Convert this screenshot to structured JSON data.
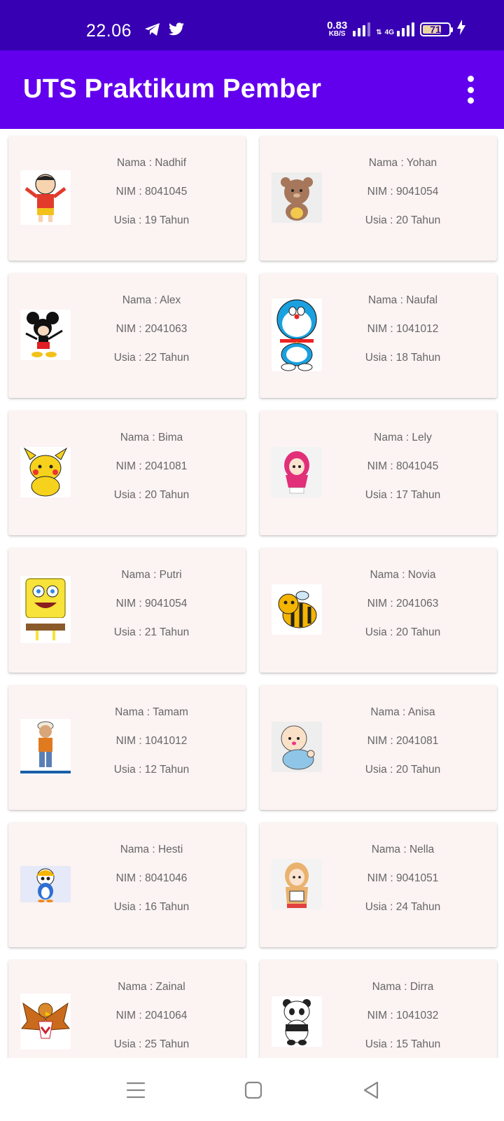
{
  "status_bar": {
    "time": "22.06",
    "net_speed": "0.83",
    "net_speed_unit": "KB/S",
    "network_type": "4G",
    "battery_level": "71",
    "icons": [
      "telegram-icon",
      "twitter-icon",
      "signal-icon",
      "data-arrows-icon",
      "charging-icon"
    ]
  },
  "app_bar": {
    "title": "UTS Praktikum Pember",
    "overflow_icon": "more-vert-icon"
  },
  "students": [
    {
      "nama": "Nama : Nadhif",
      "nim": "NIM : 8041045",
      "usia": "Usia : 19 Tahun",
      "avatar": "shinchan-avatar",
      "avatar_bg": "#ffffff"
    },
    {
      "nama": "Nama : Yohan",
      "nim": "NIM : 9041054",
      "usia": "Usia : 20 Tahun",
      "avatar": "bear-avatar",
      "avatar_bg": "#eeeeee"
    },
    {
      "nama": "Nama : Alex",
      "nim": "NIM : 2041063",
      "usia": "Usia : 22 Tahun",
      "avatar": "mickey-avatar",
      "avatar_bg": "#ffffff"
    },
    {
      "nama": "Nama : Naufal",
      "nim": "NIM : 1041012",
      "usia": "Usia : 18 Tahun",
      "avatar": "doraemon-avatar",
      "avatar_bg": "#ffffff"
    },
    {
      "nama": "Nama : Bima",
      "nim": "NIM : 2041081",
      "usia": "Usia : 20 Tahun",
      "avatar": "pikachu-avatar",
      "avatar_bg": "#ffffff"
    },
    {
      "nama": "Nama : Lely",
      "nim": "NIM : 8041045",
      "usia": "Usia : 17 Tahun",
      "avatar": "hijab-girl-avatar",
      "avatar_bg": "#f3f3f3"
    },
    {
      "nama": "Nama : Putri",
      "nim": "NIM : 9041054",
      "usia": "Usia : 21 Tahun",
      "avatar": "spongebob-avatar",
      "avatar_bg": "#ffffff"
    },
    {
      "nama": "Nama : Novia",
      "nim": "NIM : 2041063",
      "usia": "Usia : 20 Tahun",
      "avatar": "bee-avatar",
      "avatar_bg": "#ffffff"
    },
    {
      "nama": "Nama : Tamam",
      "nim": "NIM : 1041012",
      "usia": "Usia : 12 Tahun",
      "avatar": "boy-avatar",
      "avatar_bg": "#ffffff"
    },
    {
      "nama": "Nama : Anisa",
      "nim": "NIM : 2041081",
      "usia": "Usia : 20 Tahun",
      "avatar": "baby-avatar",
      "avatar_bg": "#eeeeee"
    },
    {
      "nama": "Nama : Hesti",
      "nim": "NIM : 8041046",
      "usia": "Usia : 16 Tahun",
      "avatar": "pororo-avatar",
      "avatar_bg": "#e6e9f7"
    },
    {
      "nama": "Nama : Nella",
      "nim": "NIM : 9041051",
      "usia": "Usia : 24 Tahun",
      "avatar": "hijab-reader-avatar",
      "avatar_bg": "#f3f3f3"
    },
    {
      "nama": "Nama : Zainal",
      "nim": "NIM : 2041064",
      "usia": "Usia : 25 Tahun",
      "avatar": "eagle-avatar",
      "avatar_bg": "#ffffff"
    },
    {
      "nama": "Nama : Dirra",
      "nim": "NIM : 1041032",
      "usia": "Usia : 15 Tahun",
      "avatar": "panda-avatar",
      "avatar_bg": "#ffffff"
    }
  ],
  "nav_bar": {
    "buttons": [
      "recents-menu-icon",
      "home-square-icon",
      "back-triangle-icon"
    ]
  },
  "colors": {
    "status_bar": "#3700b3",
    "app_bar": "#6200ee",
    "card": "#fcf3f3",
    "text": "#666666"
  }
}
